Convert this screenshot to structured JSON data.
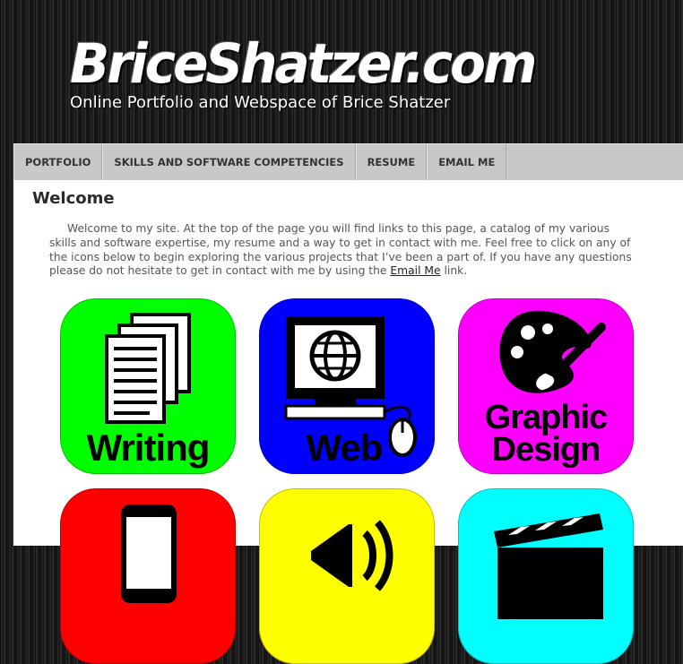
{
  "site": {
    "logo": "BriceShatzer.com",
    "tagline": "Online Portfolio and Webspace of Brice Shatzer"
  },
  "nav": {
    "items": [
      {
        "label": "PORTFOLIO"
      },
      {
        "label": "SKILLS AND SOFTWARE COMPETENCIES"
      },
      {
        "label": "RESUME"
      },
      {
        "label": "EMAIL ME"
      }
    ]
  },
  "main": {
    "title": "Welcome",
    "intro_text": "Welcome to my site. At the top of the page you will find links to this page, a catalog of my various skills and software expertise, my resume and a way to get in contact with me. Feel free to click on any of the icons below to begin exploring the various projects that I’ve been a part of. If you have any questions please do not hesitate to get in contact with me by using the ",
    "intro_link": "Email Me",
    "intro_end": " link."
  },
  "tiles": [
    {
      "label": "Writing",
      "color": "#00ff00",
      "icon": "documents-icon"
    },
    {
      "label": "Web",
      "color": "#0000ff",
      "icon": "computer-icon"
    },
    {
      "label_line1": "Graphic",
      "label_line2": "Design",
      "color": "#ff00ff",
      "icon": "palette-icon"
    },
    {
      "color": "#ff0000",
      "icon": "phone-icon"
    },
    {
      "color": "#ffff00",
      "icon": "megaphone-icon"
    },
    {
      "color": "#00ffff",
      "icon": "clapperboard-icon"
    }
  ]
}
